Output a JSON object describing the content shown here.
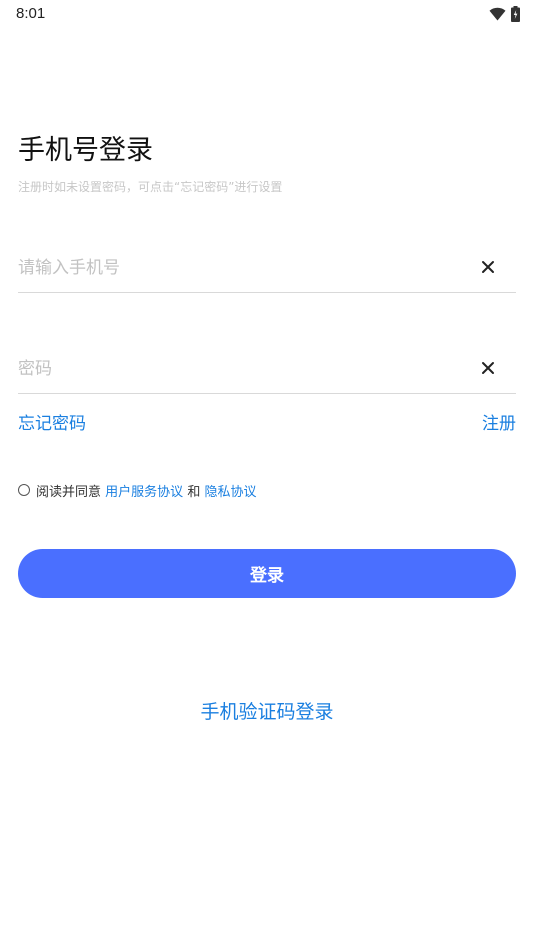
{
  "status_bar": {
    "time": "8:01"
  },
  "header": {
    "title": "手机号登录",
    "hint": "注册时如未设置密码，可点击“忘记密码”进行设置"
  },
  "form": {
    "phone_placeholder": "请输入手机号",
    "password_placeholder": "密码",
    "forgot_password": "忘记密码",
    "register": "注册"
  },
  "agreement": {
    "prefix": "阅读并同意",
    "user_agreement": "用户服务协议",
    "and": "和",
    "privacy_agreement": "隐私协议"
  },
  "buttons": {
    "login": "登录",
    "sms_login": "手机验证码登录"
  },
  "colors": {
    "accent": "#4a6fff",
    "link": "#1a7fe0"
  },
  "icons": {
    "wifi": "wifi-icon",
    "battery": "battery-icon",
    "clear": "close-icon"
  }
}
